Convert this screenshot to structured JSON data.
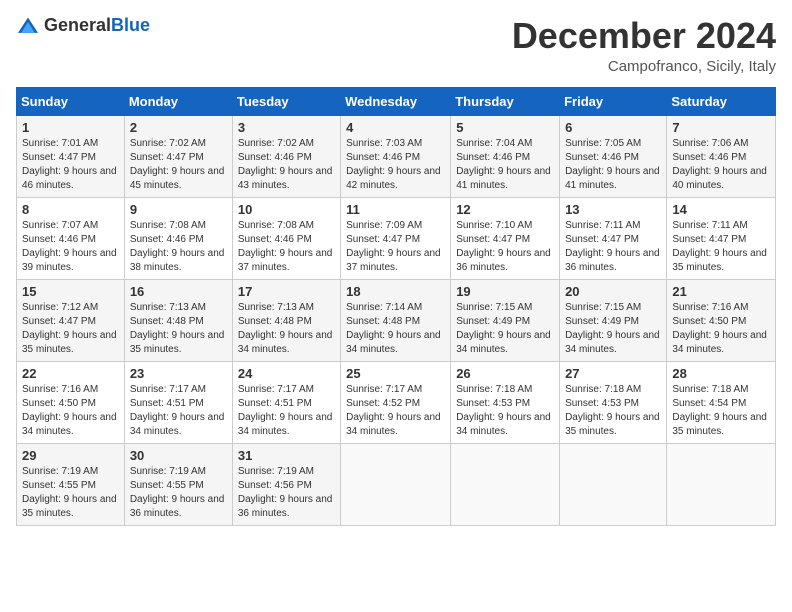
{
  "header": {
    "logo_general": "General",
    "logo_blue": "Blue",
    "month_title": "December 2024",
    "location": "Campofranco, Sicily, Italy"
  },
  "weekdays": [
    "Sunday",
    "Monday",
    "Tuesday",
    "Wednesday",
    "Thursday",
    "Friday",
    "Saturday"
  ],
  "days": [
    {
      "date": "1",
      "sunrise": "7:01 AM",
      "sunset": "4:47 PM",
      "daylight": "9 hours and 46 minutes."
    },
    {
      "date": "2",
      "sunrise": "7:02 AM",
      "sunset": "4:47 PM",
      "daylight": "9 hours and 45 minutes."
    },
    {
      "date": "3",
      "sunrise": "7:02 AM",
      "sunset": "4:46 PM",
      "daylight": "9 hours and 43 minutes."
    },
    {
      "date": "4",
      "sunrise": "7:03 AM",
      "sunset": "4:46 PM",
      "daylight": "9 hours and 42 minutes."
    },
    {
      "date": "5",
      "sunrise": "7:04 AM",
      "sunset": "4:46 PM",
      "daylight": "9 hours and 41 minutes."
    },
    {
      "date": "6",
      "sunrise": "7:05 AM",
      "sunset": "4:46 PM",
      "daylight": "9 hours and 41 minutes."
    },
    {
      "date": "7",
      "sunrise": "7:06 AM",
      "sunset": "4:46 PM",
      "daylight": "9 hours and 40 minutes."
    },
    {
      "date": "8",
      "sunrise": "7:07 AM",
      "sunset": "4:46 PM",
      "daylight": "9 hours and 39 minutes."
    },
    {
      "date": "9",
      "sunrise": "7:08 AM",
      "sunset": "4:46 PM",
      "daylight": "9 hours and 38 minutes."
    },
    {
      "date": "10",
      "sunrise": "7:08 AM",
      "sunset": "4:46 PM",
      "daylight": "9 hours and 37 minutes."
    },
    {
      "date": "11",
      "sunrise": "7:09 AM",
      "sunset": "4:47 PM",
      "daylight": "9 hours and 37 minutes."
    },
    {
      "date": "12",
      "sunrise": "7:10 AM",
      "sunset": "4:47 PM",
      "daylight": "9 hours and 36 minutes."
    },
    {
      "date": "13",
      "sunrise": "7:11 AM",
      "sunset": "4:47 PM",
      "daylight": "9 hours and 36 minutes."
    },
    {
      "date": "14",
      "sunrise": "7:11 AM",
      "sunset": "4:47 PM",
      "daylight": "9 hours and 35 minutes."
    },
    {
      "date": "15",
      "sunrise": "7:12 AM",
      "sunset": "4:47 PM",
      "daylight": "9 hours and 35 minutes."
    },
    {
      "date": "16",
      "sunrise": "7:13 AM",
      "sunset": "4:48 PM",
      "daylight": "9 hours and 35 minutes."
    },
    {
      "date": "17",
      "sunrise": "7:13 AM",
      "sunset": "4:48 PM",
      "daylight": "9 hours and 34 minutes."
    },
    {
      "date": "18",
      "sunrise": "7:14 AM",
      "sunset": "4:48 PM",
      "daylight": "9 hours and 34 minutes."
    },
    {
      "date": "19",
      "sunrise": "7:15 AM",
      "sunset": "4:49 PM",
      "daylight": "9 hours and 34 minutes."
    },
    {
      "date": "20",
      "sunrise": "7:15 AM",
      "sunset": "4:49 PM",
      "daylight": "9 hours and 34 minutes."
    },
    {
      "date": "21",
      "sunrise": "7:16 AM",
      "sunset": "4:50 PM",
      "daylight": "9 hours and 34 minutes."
    },
    {
      "date": "22",
      "sunrise": "7:16 AM",
      "sunset": "4:50 PM",
      "daylight": "9 hours and 34 minutes."
    },
    {
      "date": "23",
      "sunrise": "7:17 AM",
      "sunset": "4:51 PM",
      "daylight": "9 hours and 34 minutes."
    },
    {
      "date": "24",
      "sunrise": "7:17 AM",
      "sunset": "4:51 PM",
      "daylight": "9 hours and 34 minutes."
    },
    {
      "date": "25",
      "sunrise": "7:17 AM",
      "sunset": "4:52 PM",
      "daylight": "9 hours and 34 minutes."
    },
    {
      "date": "26",
      "sunrise": "7:18 AM",
      "sunset": "4:53 PM",
      "daylight": "9 hours and 34 minutes."
    },
    {
      "date": "27",
      "sunrise": "7:18 AM",
      "sunset": "4:53 PM",
      "daylight": "9 hours and 35 minutes."
    },
    {
      "date": "28",
      "sunrise": "7:18 AM",
      "sunset": "4:54 PM",
      "daylight": "9 hours and 35 minutes."
    },
    {
      "date": "29",
      "sunrise": "7:19 AM",
      "sunset": "4:55 PM",
      "daylight": "9 hours and 35 minutes."
    },
    {
      "date": "30",
      "sunrise": "7:19 AM",
      "sunset": "4:55 PM",
      "daylight": "9 hours and 36 minutes."
    },
    {
      "date": "31",
      "sunrise": "7:19 AM",
      "sunset": "4:56 PM",
      "daylight": "9 hours and 36 minutes."
    }
  ]
}
